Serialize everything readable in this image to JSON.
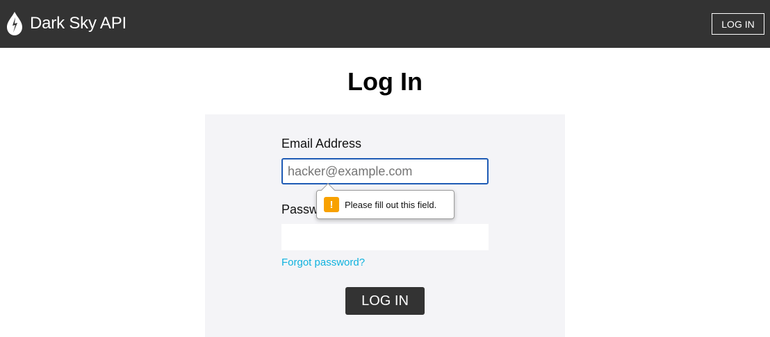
{
  "header": {
    "brand": "Dark Sky API",
    "login_label": "LOG IN",
    "logo_icon": "raindrop-icon"
  },
  "page": {
    "title": "Log In"
  },
  "form": {
    "email_label": "Email Address",
    "email_placeholder": "hacker@example.com",
    "email_value": "",
    "password_label": "Password",
    "password_value": "",
    "forgot_link": "Forgot password?",
    "submit_label": "LOG IN"
  },
  "validation_tooltip": {
    "message": "Please fill out this field.",
    "icon": "warning-icon",
    "icon_glyph": "!"
  },
  "colors": {
    "header_bg": "#333333",
    "panel_bg": "#f4f4f7",
    "link": "#0fb2de",
    "focus_border": "#1e5bb5",
    "warning": "#f8a100"
  }
}
